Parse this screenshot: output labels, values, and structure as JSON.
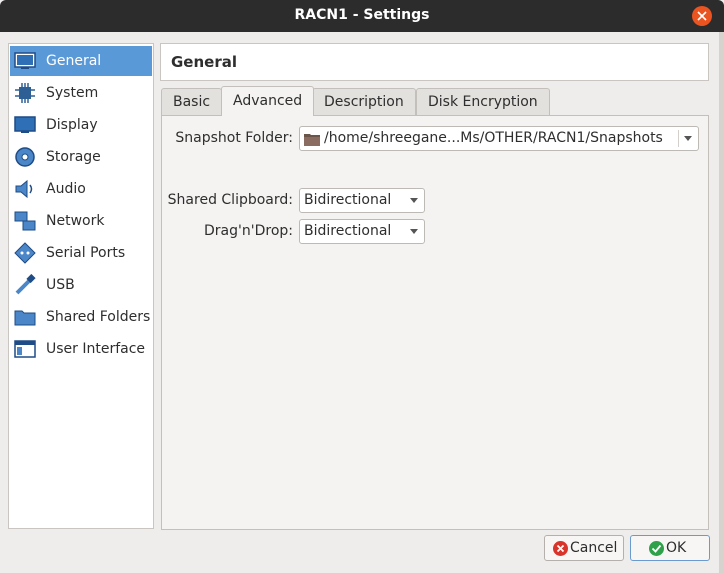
{
  "window": {
    "title": "RACN1 - Settings"
  },
  "sidebar": {
    "items": [
      {
        "label": "General",
        "icon": "general-icon",
        "selected": true
      },
      {
        "label": "System",
        "icon": "system-chip-icon"
      },
      {
        "label": "Display",
        "icon": "display-monitor-icon"
      },
      {
        "label": "Storage",
        "icon": "storage-disk-icon"
      },
      {
        "label": "Audio",
        "icon": "audio-speaker-icon"
      },
      {
        "label": "Network",
        "icon": "network-icon"
      },
      {
        "label": "Serial Ports",
        "icon": "serial-port-icon"
      },
      {
        "label": "USB",
        "icon": "usb-icon"
      },
      {
        "label": "Shared Folders",
        "icon": "shared-folder-icon"
      },
      {
        "label": "User Interface",
        "icon": "user-interface-icon"
      }
    ]
  },
  "header": {
    "title": "General"
  },
  "tabs": [
    {
      "label": "Basic"
    },
    {
      "label": "Advanced",
      "active": true
    },
    {
      "label": "Description"
    },
    {
      "label": "Disk Encryption"
    }
  ],
  "advanced": {
    "snapshot_folder_label": "Snapshot Folder:",
    "snapshot_folder_value": "/home/shreegane...Ms/OTHER/RACN1/Snapshots",
    "shared_clipboard_label": "Shared Clipboard:",
    "shared_clipboard_value": "Bidirectional",
    "drag_drop_label": "Drag'n'Drop:",
    "drag_drop_value": "Bidirectional"
  },
  "buttons": {
    "cancel_label": "Cancel",
    "ok_label": "OK"
  },
  "colors": {
    "selected_bg": "#5a99d8",
    "close_button": "#e95420",
    "titlebar": "#2c2c2c"
  }
}
